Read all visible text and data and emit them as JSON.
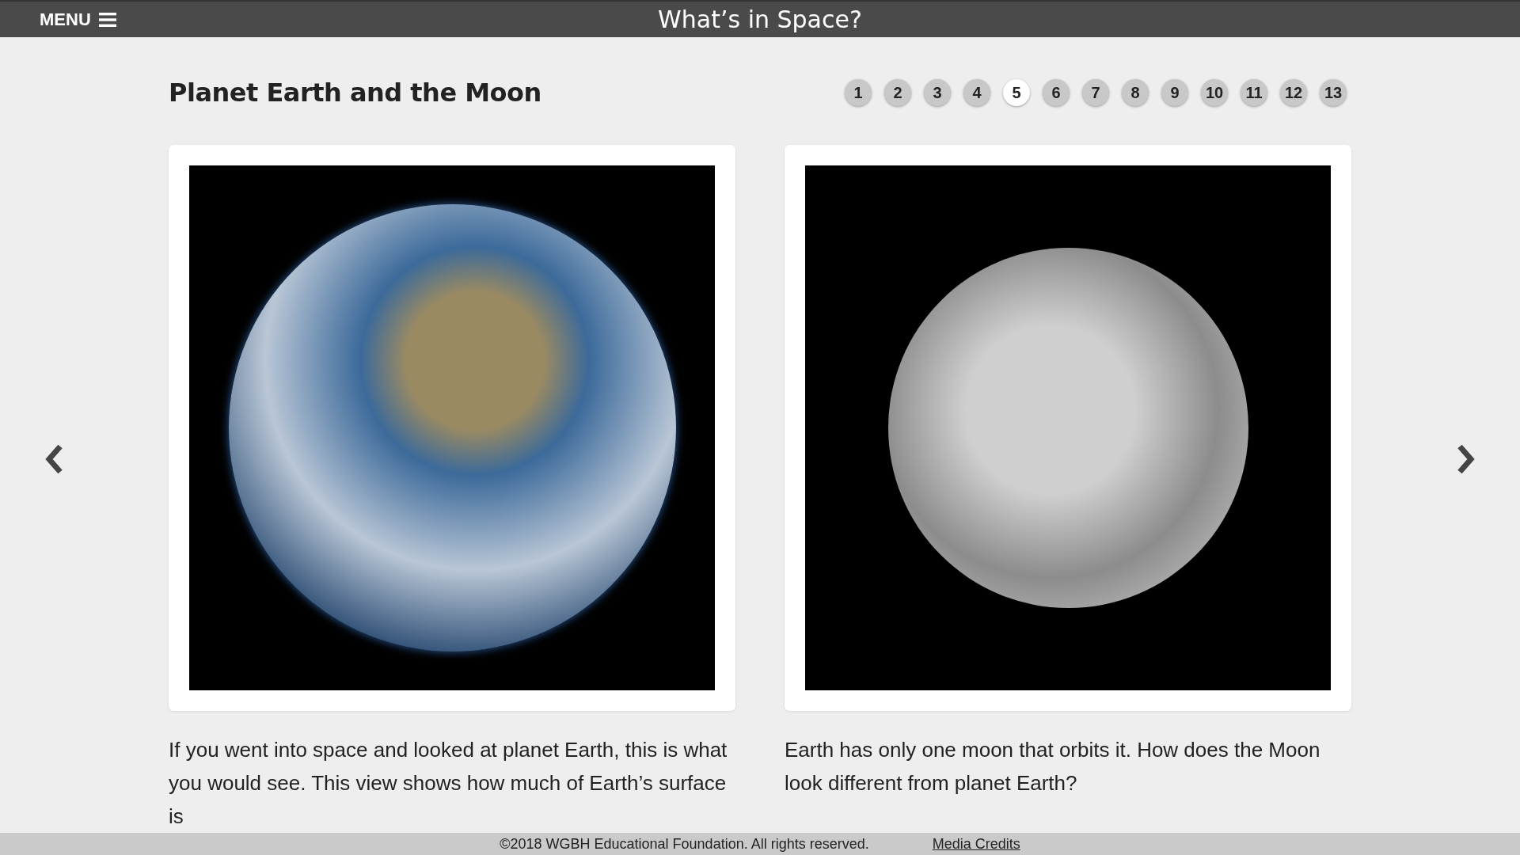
{
  "header": {
    "menu_label": "MENU",
    "title": "What’s in Space?"
  },
  "page": {
    "title": "Planet Earth and the Moon",
    "pages": [
      {
        "label": "1",
        "selected": false
      },
      {
        "label": "2",
        "selected": false
      },
      {
        "label": "3",
        "selected": false
      },
      {
        "label": "4",
        "selected": false
      },
      {
        "label": "5",
        "selected": true
      },
      {
        "label": "6",
        "selected": false
      },
      {
        "label": "7",
        "selected": false
      },
      {
        "label": "8",
        "selected": false
      },
      {
        "label": "9",
        "selected": false
      },
      {
        "label": "10",
        "selected": false
      },
      {
        "label": "11",
        "selected": false
      },
      {
        "label": "12",
        "selected": false
      },
      {
        "label": "13",
        "selected": false
      }
    ],
    "panels": [
      {
        "kind": "earth",
        "caption": "If you went into space and looked at planet Earth, this is what you would see. This view shows how much of Earth’s surface is"
      },
      {
        "kind": "moon",
        "caption": "Earth has only one moon that orbits it. How does the Moon look different from planet Earth?"
      }
    ]
  },
  "footer": {
    "copyright": "©2018 WGBH Educational Foundation. All rights reserved.",
    "link": "Media Credits"
  }
}
